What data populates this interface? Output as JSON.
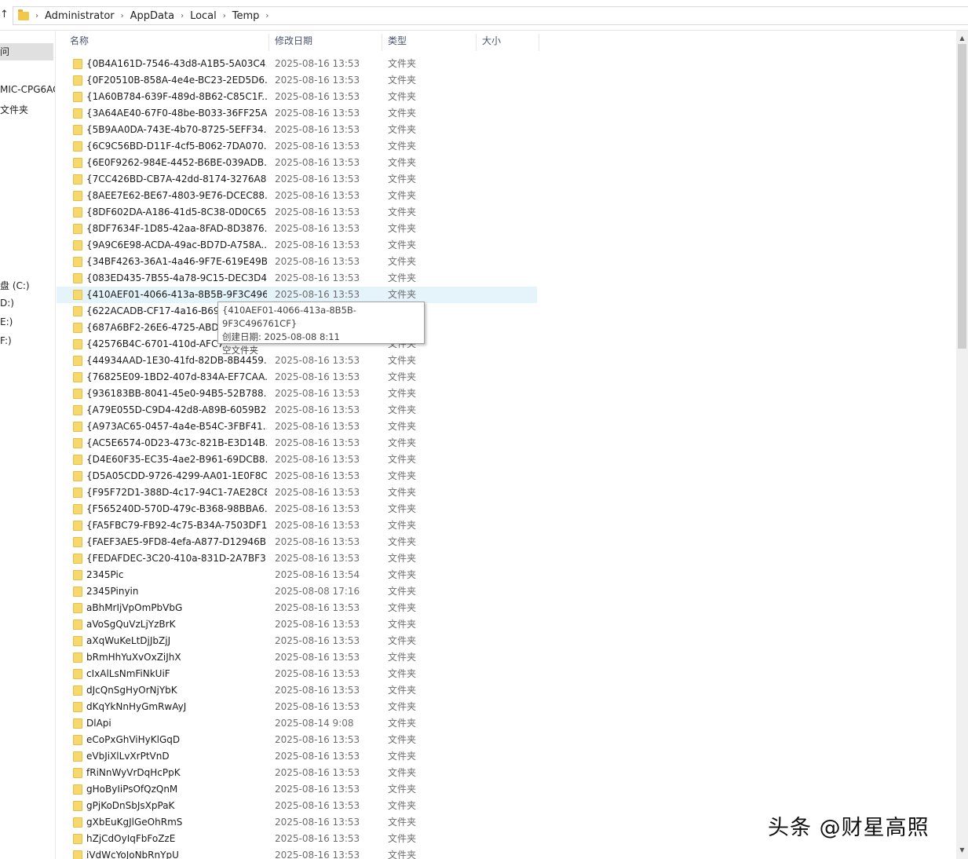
{
  "address_bar": {
    "breadcrumbs": [
      "Administrator",
      "AppData",
      "Local",
      "Temp"
    ]
  },
  "nav_pane": {
    "items": [
      {
        "label": "问",
        "selected": true
      },
      {
        "label": "MIC-CPG6AC"
      },
      {
        "label": "文件夹"
      },
      {
        "label": "盘 (C:)"
      },
      {
        "label": "D:)"
      },
      {
        "label": "E:)"
      },
      {
        "label": "F:)"
      }
    ]
  },
  "file_list": {
    "columns": {
      "name": "名称",
      "date": "修改日期",
      "type": "类型",
      "size": "大小"
    },
    "rows": [
      {
        "name": "{0B4A161D-7546-43d8-A1B5-5A03C4...",
        "date": "2025-08-16 13:53",
        "type": "文件夹"
      },
      {
        "name": "{0F20510B-858A-4e4e-BC23-2ED5D6...",
        "date": "2025-08-16 13:53",
        "type": "文件夹"
      },
      {
        "name": "{1A60B784-639F-489d-8B62-C85C1F...",
        "date": "2025-08-16 13:53",
        "type": "文件夹"
      },
      {
        "name": "{3A64AE40-67F0-48be-B033-36FF25A...",
        "date": "2025-08-16 13:53",
        "type": "文件夹"
      },
      {
        "name": "{5B9AA0DA-743E-4b70-8725-5EFF34...",
        "date": "2025-08-16 13:53",
        "type": "文件夹"
      },
      {
        "name": "{6C9C56BD-D11F-4cf5-B062-7DA070...",
        "date": "2025-08-16 13:53",
        "type": "文件夹"
      },
      {
        "name": "{6E0F9262-984E-4452-B6BE-039ADB...",
        "date": "2025-08-16 13:53",
        "type": "文件夹"
      },
      {
        "name": "{7CC426BD-CB7A-42dd-8174-3276A8...",
        "date": "2025-08-16 13:53",
        "type": "文件夹"
      },
      {
        "name": "{8AEE7E62-BE67-4803-9E76-DCEC88...",
        "date": "2025-08-16 13:53",
        "type": "文件夹"
      },
      {
        "name": "{8DF602DA-A186-41d5-8C38-0D0C65...",
        "date": "2025-08-16 13:53",
        "type": "文件夹"
      },
      {
        "name": "{8DF7634F-1D85-42aa-8FAD-8D3876...",
        "date": "2025-08-16 13:53",
        "type": "文件夹"
      },
      {
        "name": "{9A9C6E98-ACDA-49ac-BD7D-A758A...",
        "date": "2025-08-16 13:53",
        "type": "文件夹"
      },
      {
        "name": "{34BF4263-36A1-4a46-9F7E-619E49B...",
        "date": "2025-08-16 13:53",
        "type": "文件夹"
      },
      {
        "name": "{083ED435-7B55-4a78-9C15-DEC3D4...",
        "date": "2025-08-16 13:53",
        "type": "文件夹"
      },
      {
        "name": "{410AEF01-4066-413a-8B5B-9F3C496...",
        "date": "2025-08-16 13:53",
        "type": "文件夹",
        "hover": true
      },
      {
        "name": "{622ACADB-CF17-4a16-B69F",
        "date": "",
        "type": ""
      },
      {
        "name": "{687A6BF2-26E6-4725-ABDD",
        "date": "",
        "type": ""
      },
      {
        "name": "{42576B4C-6701-410d-AFC7",
        "date": "",
        "type": "文件夹"
      },
      {
        "name": "{44934AAD-1E30-41fd-82DB-8B4459...",
        "date": "2025-08-16 13:53",
        "type": "文件夹"
      },
      {
        "name": "{76825E09-1BD2-407d-834A-EF7CAA...",
        "date": "2025-08-16 13:53",
        "type": "文件夹"
      },
      {
        "name": "{936183BB-8041-45e0-94B5-52B788...",
        "date": "2025-08-16 13:53",
        "type": "文件夹"
      },
      {
        "name": "{A79E055D-C9D4-42d8-A89B-6059B2...",
        "date": "2025-08-16 13:53",
        "type": "文件夹"
      },
      {
        "name": "{A973AC65-0457-4a4e-B54C-3FBF41...",
        "date": "2025-08-16 13:53",
        "type": "文件夹"
      },
      {
        "name": "{AC5E6574-0D23-473c-821B-E3D14B...",
        "date": "2025-08-16 13:53",
        "type": "文件夹"
      },
      {
        "name": "{D4E60F35-EC35-4ae2-B961-69DCB8...",
        "date": "2025-08-16 13:53",
        "type": "文件夹"
      },
      {
        "name": "{D5A05CDD-9726-4299-AA01-1E0F8C...",
        "date": "2025-08-16 13:53",
        "type": "文件夹"
      },
      {
        "name": "{F95F72D1-388D-4c17-94C1-7AE28C8...",
        "date": "2025-08-16 13:53",
        "type": "文件夹"
      },
      {
        "name": "{F565240D-570D-479c-B368-98BBA6...",
        "date": "2025-08-16 13:53",
        "type": "文件夹"
      },
      {
        "name": "{FA5FBC79-FB92-4c75-B34A-7503DF1...",
        "date": "2025-08-16 13:53",
        "type": "文件夹"
      },
      {
        "name": "{FAEF3AE5-9FD8-4efa-A877-D12946B...",
        "date": "2025-08-16 13:53",
        "type": "文件夹"
      },
      {
        "name": "{FEDAFDEC-3C20-410a-831D-2A7BF3...",
        "date": "2025-08-16 13:53",
        "type": "文件夹"
      },
      {
        "name": "2345Pic",
        "date": "2025-08-16 13:54",
        "type": "文件夹"
      },
      {
        "name": "2345Pinyin",
        "date": "2025-08-08 17:16",
        "type": "文件夹"
      },
      {
        "name": "aBhMrIjVpOmPbVbG",
        "date": "2025-08-16 13:53",
        "type": "文件夹"
      },
      {
        "name": "aVoSgQuVzLjYzBrK",
        "date": "2025-08-16 13:53",
        "type": "文件夹"
      },
      {
        "name": "aXqWuKeLtDjJbZjJ",
        "date": "2025-08-16 13:53",
        "type": "文件夹"
      },
      {
        "name": "bRmHhYuXvOxZiJhX",
        "date": "2025-08-16 13:53",
        "type": "文件夹"
      },
      {
        "name": "cIxAlLsNmFiNkUiF",
        "date": "2025-08-16 13:53",
        "type": "文件夹"
      },
      {
        "name": "dJcQnSgHyOrNjYbK",
        "date": "2025-08-16 13:53",
        "type": "文件夹"
      },
      {
        "name": "dKqYkNnHyGmRwAyJ",
        "date": "2025-08-16 13:53",
        "type": "文件夹"
      },
      {
        "name": "DlApi",
        "date": "2025-08-14 9:08",
        "type": "文件夹"
      },
      {
        "name": "eCoPxGhViHyKlGqD",
        "date": "2025-08-16 13:53",
        "type": "文件夹"
      },
      {
        "name": "eVbJiXlLvXrPtVnD",
        "date": "2025-08-16 13:53",
        "type": "文件夹"
      },
      {
        "name": "fRiNnWyVrDqHcPpK",
        "date": "2025-08-16 13:53",
        "type": "文件夹"
      },
      {
        "name": "gHoByIiPsOfQzQnM",
        "date": "2025-08-16 13:53",
        "type": "文件夹"
      },
      {
        "name": "gPjKoDnSbJsXpPaK",
        "date": "2025-08-16 13:53",
        "type": "文件夹"
      },
      {
        "name": "gXbEuKgJlGeOhRmS",
        "date": "2025-08-16 13:53",
        "type": "文件夹"
      },
      {
        "name": "hZjCdOyIqFbFoZzE",
        "date": "2025-08-16 13:53",
        "type": "文件夹"
      },
      {
        "name": "iVdWcYoJoNbRnYpU",
        "date": "2025-08-16 13:53",
        "type": "文件夹"
      }
    ]
  },
  "tooltip": {
    "line1": "{410AEF01-4066-413a-8B5B-9F3C496761CF}",
    "line2": "创建日期: 2025-08-08 8:11",
    "line3": "空文件夹"
  },
  "watermark": "头条 @财星高照"
}
